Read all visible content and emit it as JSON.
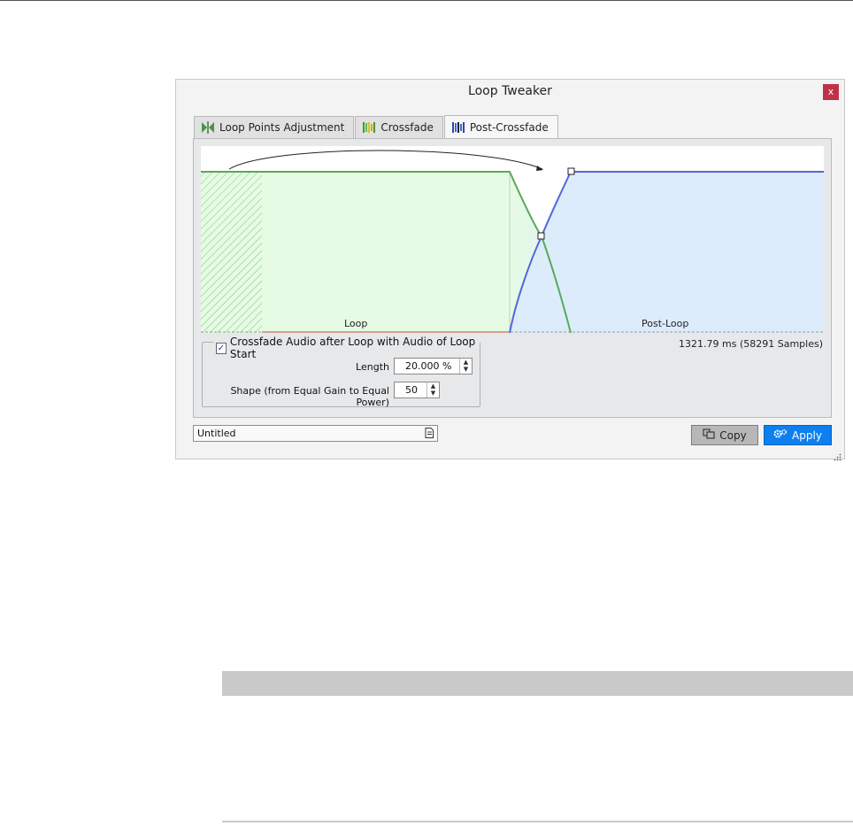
{
  "window": {
    "title": "Loop Tweaker",
    "close_label": "x"
  },
  "tabs": [
    {
      "label": "Loop Points Adjustment",
      "icon": "loop-points-icon",
      "active": false
    },
    {
      "label": "Crossfade",
      "icon": "crossfade-icon",
      "active": false
    },
    {
      "label": "Post-Crossfade",
      "icon": "post-crossfade-icon",
      "active": true
    }
  ],
  "graph": {
    "loop_label": "Loop",
    "post_loop_label": "Post-Loop",
    "duration": "1321.79 ms (58291 Samples)",
    "colors": {
      "loop_fill": "#e6fbe4",
      "loop_line": "#5aa85a",
      "post_fill": "#dcecfa",
      "post_line": "#5566dd"
    }
  },
  "crossfade": {
    "checkbox_label": "Crossfade Audio after Loop with Audio of Loop Start",
    "checked": true,
    "length_label": "Length",
    "length_value": "20.000 %",
    "shape_label": "Shape (from Equal Gain to Equal Power)",
    "shape_value": "50"
  },
  "preset": {
    "value": "Untitled"
  },
  "buttons": {
    "copy_label": "Copy",
    "apply_label": "Apply"
  },
  "colors": {
    "apply_bg": "#0d7ff0",
    "close_bg": "#c0304a"
  }
}
